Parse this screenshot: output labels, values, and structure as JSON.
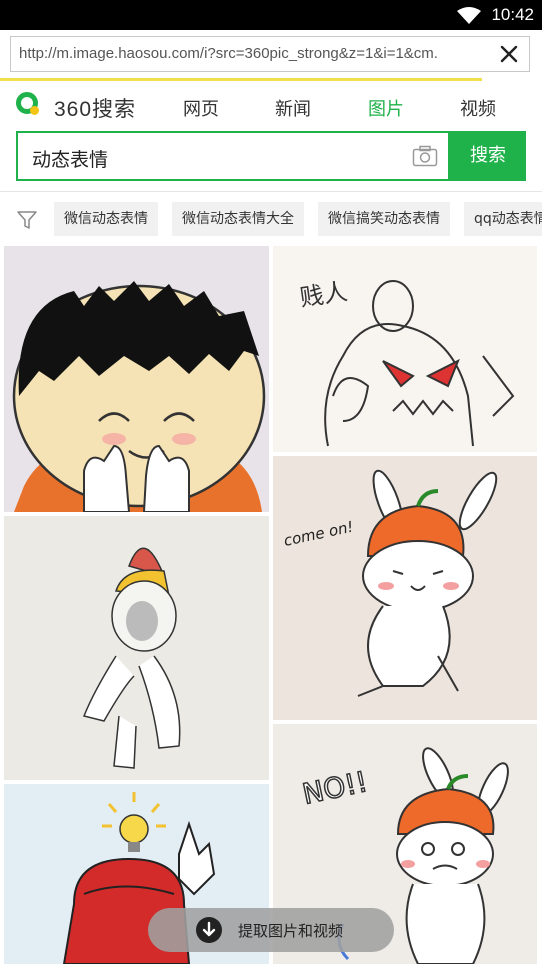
{
  "status": {
    "time": "10:42"
  },
  "browser": {
    "url": "http://m.image.haosou.com/i?src=360pic_strong&z=1&i=1&cm."
  },
  "header": {
    "logo_text": "360搜索",
    "tabs": [
      {
        "label": "网页",
        "active": false
      },
      {
        "label": "新闻",
        "active": false
      },
      {
        "label": "图片",
        "active": true
      },
      {
        "label": "视频",
        "active": false
      }
    ]
  },
  "search": {
    "query": "动态表情",
    "button_label": "搜索"
  },
  "filters": [
    "微信动态表情",
    "微信动态表情大全",
    "微信搞笑动态表情",
    "qq动态表情"
  ],
  "images": {
    "tile2_text": "贱人",
    "tile3_text": "come on!",
    "tile5_text": "NO!!"
  },
  "extract_label": "提取图片和视频",
  "colors": {
    "accent": "#20b24a",
    "progress": "#f0e14a"
  }
}
